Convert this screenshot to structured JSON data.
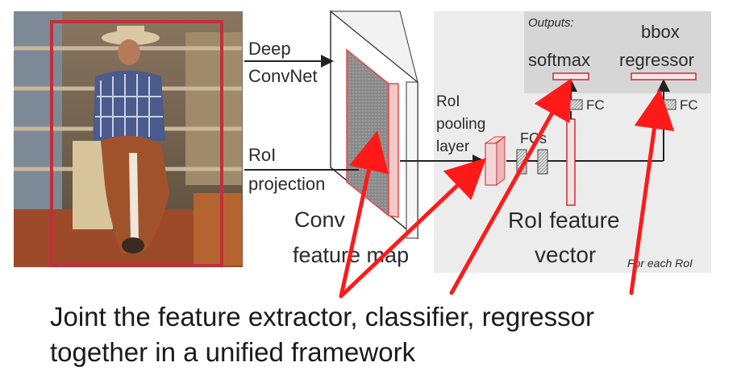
{
  "labels": {
    "deep_convnet": [
      "Deep",
      "ConvNet"
    ],
    "roi_projection": [
      "RoI",
      "projection"
    ],
    "conv_feature_map": [
      "Conv",
      "feature map"
    ],
    "roi_pooling_layer": [
      "RoI",
      "pooling",
      "layer"
    ],
    "fcs": "FCs",
    "roi_feature_vector": [
      "RoI feature",
      "vector"
    ],
    "outputs": "Outputs:",
    "softmax": "softmax",
    "bbox_regressor": [
      "bbox",
      "regressor"
    ],
    "fc_left": "FC",
    "fc_right": "FC",
    "for_each_roi": "For each RoI"
  },
  "caption": {
    "line1": "Joint the feature extractor, classifier, regressor",
    "line2": "together in a unified framework"
  },
  "colors": {
    "annotation_red": "#ff1a1a",
    "box_red": "#c0303a",
    "panel_gray": "#ececec",
    "outputs_gray": "#d6d6d6"
  }
}
